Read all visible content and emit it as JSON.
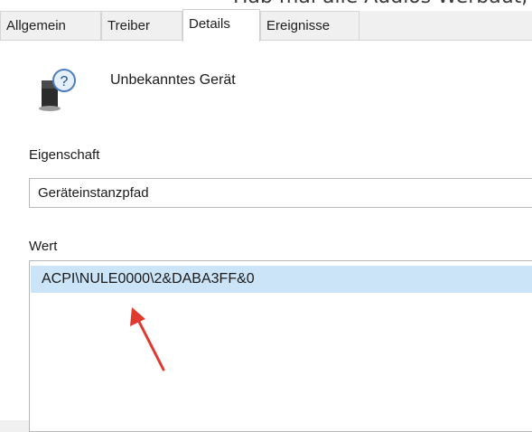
{
  "header_text": "Hab mal alle Audios Werbaut, von diesen",
  "tabs": [
    {
      "label": "Allgemein"
    },
    {
      "label": "Treiber"
    },
    {
      "label": "Details",
      "active": true
    },
    {
      "label": "Ereignisse"
    }
  ],
  "device": {
    "name": "Unbekanntes Gerät",
    "icon": "unknown-device-icon"
  },
  "property": {
    "label": "Eigenschaft",
    "selected": "Geräteinstanzpfad"
  },
  "value": {
    "label": "Wert",
    "items": [
      "ACPI\\NULE0000\\2&DABA3FF&0"
    ]
  },
  "colors": {
    "selection": "#cce4f7",
    "arrow": "#e03a2f"
  },
  "annotation": {
    "icon": "red-arrow"
  }
}
